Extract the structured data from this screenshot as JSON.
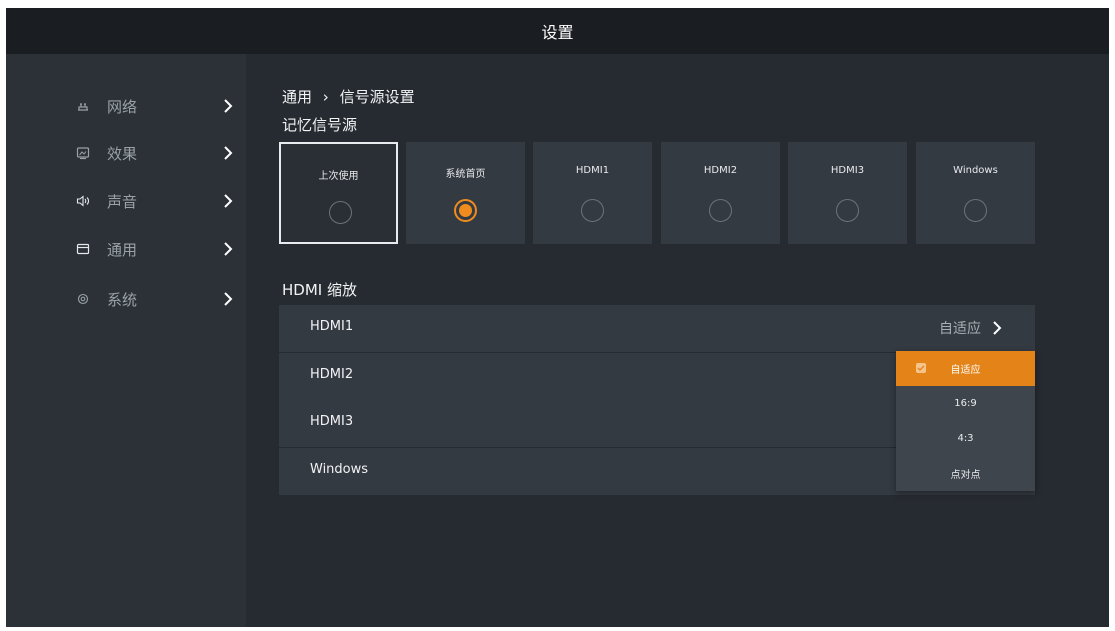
{
  "window": {
    "title": "设置"
  },
  "sidebar": {
    "items": [
      {
        "label": "网络",
        "icon": "network-icon"
      },
      {
        "label": "效果",
        "icon": "picture-icon"
      },
      {
        "label": "声音",
        "icon": "speaker-icon"
      },
      {
        "label": "通用",
        "icon": "general-icon"
      },
      {
        "label": "系统",
        "icon": "system-icon"
      }
    ]
  },
  "breadcrumb": {
    "parent": "通用",
    "separator": "›",
    "current": "信号源设置"
  },
  "memory_source": {
    "title": "记忆信号源",
    "options": [
      {
        "label": "上次使用",
        "focused": true,
        "selected": false
      },
      {
        "label": "系统首页",
        "focused": false,
        "selected": true
      },
      {
        "label": "HDMI1",
        "focused": false,
        "selected": false
      },
      {
        "label": "HDMI2",
        "focused": false,
        "selected": false
      },
      {
        "label": "HDMI3",
        "focused": false,
        "selected": false
      },
      {
        "label": "Windows",
        "focused": false,
        "selected": false
      }
    ]
  },
  "hdmi_zoom": {
    "title": "HDMI 缩放",
    "rows": [
      {
        "label": "HDMI1",
        "value": "自适应"
      },
      {
        "label": "HDMI2",
        "value": ""
      },
      {
        "label": "HDMI3",
        "value": ""
      },
      {
        "label": "Windows",
        "value": ""
      }
    ],
    "dropdown": {
      "options": [
        "自适应",
        "16:9",
        "4:3",
        "点对点"
      ],
      "selected": "自适应"
    }
  },
  "colors": {
    "accent": "#e38318",
    "background": "#262b31",
    "sidebar": "#2b3137",
    "titlebar": "#1a1d21",
    "card": "#343a42"
  }
}
